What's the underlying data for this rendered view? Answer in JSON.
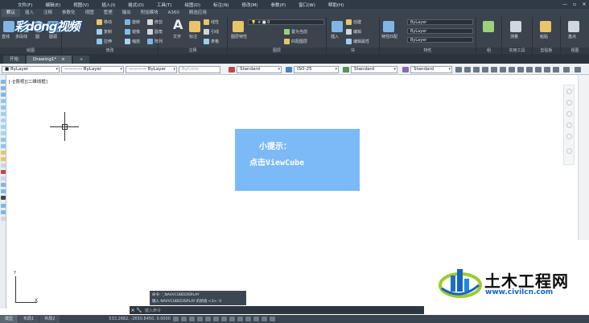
{
  "menubar": {
    "items": [
      "文件(F)",
      "编辑(E)",
      "视图(V)",
      "插入(I)",
      "格式(O)",
      "工具(T)",
      "绘图(D)",
      "标注(N)",
      "修改(M)",
      "参数(P)",
      "窗口(W)",
      "帮助(H)"
    ],
    "window_controls": [
      "—",
      "▫",
      "✕"
    ]
  },
  "ribbon_tabs": [
    "默认",
    "插入",
    "注释",
    "参数化",
    "视图",
    "管理",
    "输出",
    "附加模块",
    "A360",
    "精选应用"
  ],
  "ribbon": {
    "draw_panel": {
      "title": "绘图",
      "big_tools": [
        "直线",
        "多段线",
        "圆",
        "圆弧"
      ]
    },
    "modify_panel": {
      "title": "修改",
      "tools": [
        "移动",
        "旋转",
        "修剪",
        "复制",
        "镜像",
        "圆角",
        "拉伸",
        "缩放",
        "阵列"
      ]
    },
    "annotation_panel": {
      "title": "注释",
      "big_tools": [
        "文字",
        "标注"
      ],
      "tools": [
        "线性",
        "引线",
        "表格"
      ]
    },
    "layers_panel": {
      "title": "图层",
      "big_tools": [
        "图层特性"
      ],
      "layer_value": "0",
      "tools": [
        "置为当前",
        "匹配图层"
      ]
    },
    "block_panel": {
      "title": "块",
      "big_tools": [
        "插入"
      ],
      "tools": [
        "创建",
        "编辑",
        "编辑属性"
      ]
    },
    "properties_panel": {
      "title": "特性",
      "big_tools": [
        "特性匹配"
      ],
      "combos": [
        "ByLayer",
        "ByLayer",
        "ByLayer"
      ]
    },
    "groups_panel": {
      "title": "组"
    },
    "utilities_panel": {
      "title": "实用工具",
      "big_tools": [
        "测量"
      ]
    },
    "clipboard_panel": {
      "title": "剪贴板",
      "big_tools": [
        "粘贴"
      ]
    },
    "view_panel": {
      "title": "视图",
      "big_tools": [
        "基点"
      ]
    }
  },
  "logo_text": "彩dong视频",
  "doc_tabs": [
    {
      "label": "开始",
      "close": ""
    },
    {
      "label": "Drawing1*",
      "close": "×"
    }
  ],
  "add_tab": "+",
  "propbar": {
    "color_combo": "■ ByLayer",
    "linetype_combo": "———— ByLayer",
    "lineweight_combo": "———— ByLayer",
    "plotstyle_combo": "ByColor",
    "text_style": "Standard",
    "dim_style": "ISO-25",
    "table_style": "Standard",
    "mleader_style": "Standard"
  },
  "canvas": {
    "view_label": "[-][俯视][二维线框]"
  },
  "tip": {
    "title": "小提示：",
    "body": "点击ViewCube"
  },
  "ucs": {
    "x_label": "X",
    "y_label": "Y"
  },
  "command": {
    "history": [
      "命令: '_NAVVCUBEDISPLAY",
      "输入 NAVVCUBEDISPLAY 的新值 <3>: 0"
    ],
    "close_button": "✕",
    "search_button": "🔧",
    "placeholder": "键入命令"
  },
  "statusbar": {
    "tabs": [
      "模型",
      "布局1",
      "布局2"
    ],
    "coords": "533.2682, -2650.8450, 0.0000"
  },
  "watermark": {
    "title": "土木工程网",
    "url": "www.civilcn.com"
  },
  "colors": {
    "ribbon_bg": "#3b434d",
    "tip_bg": "#7cb9f7",
    "watermark_url": "#1565c0"
  }
}
